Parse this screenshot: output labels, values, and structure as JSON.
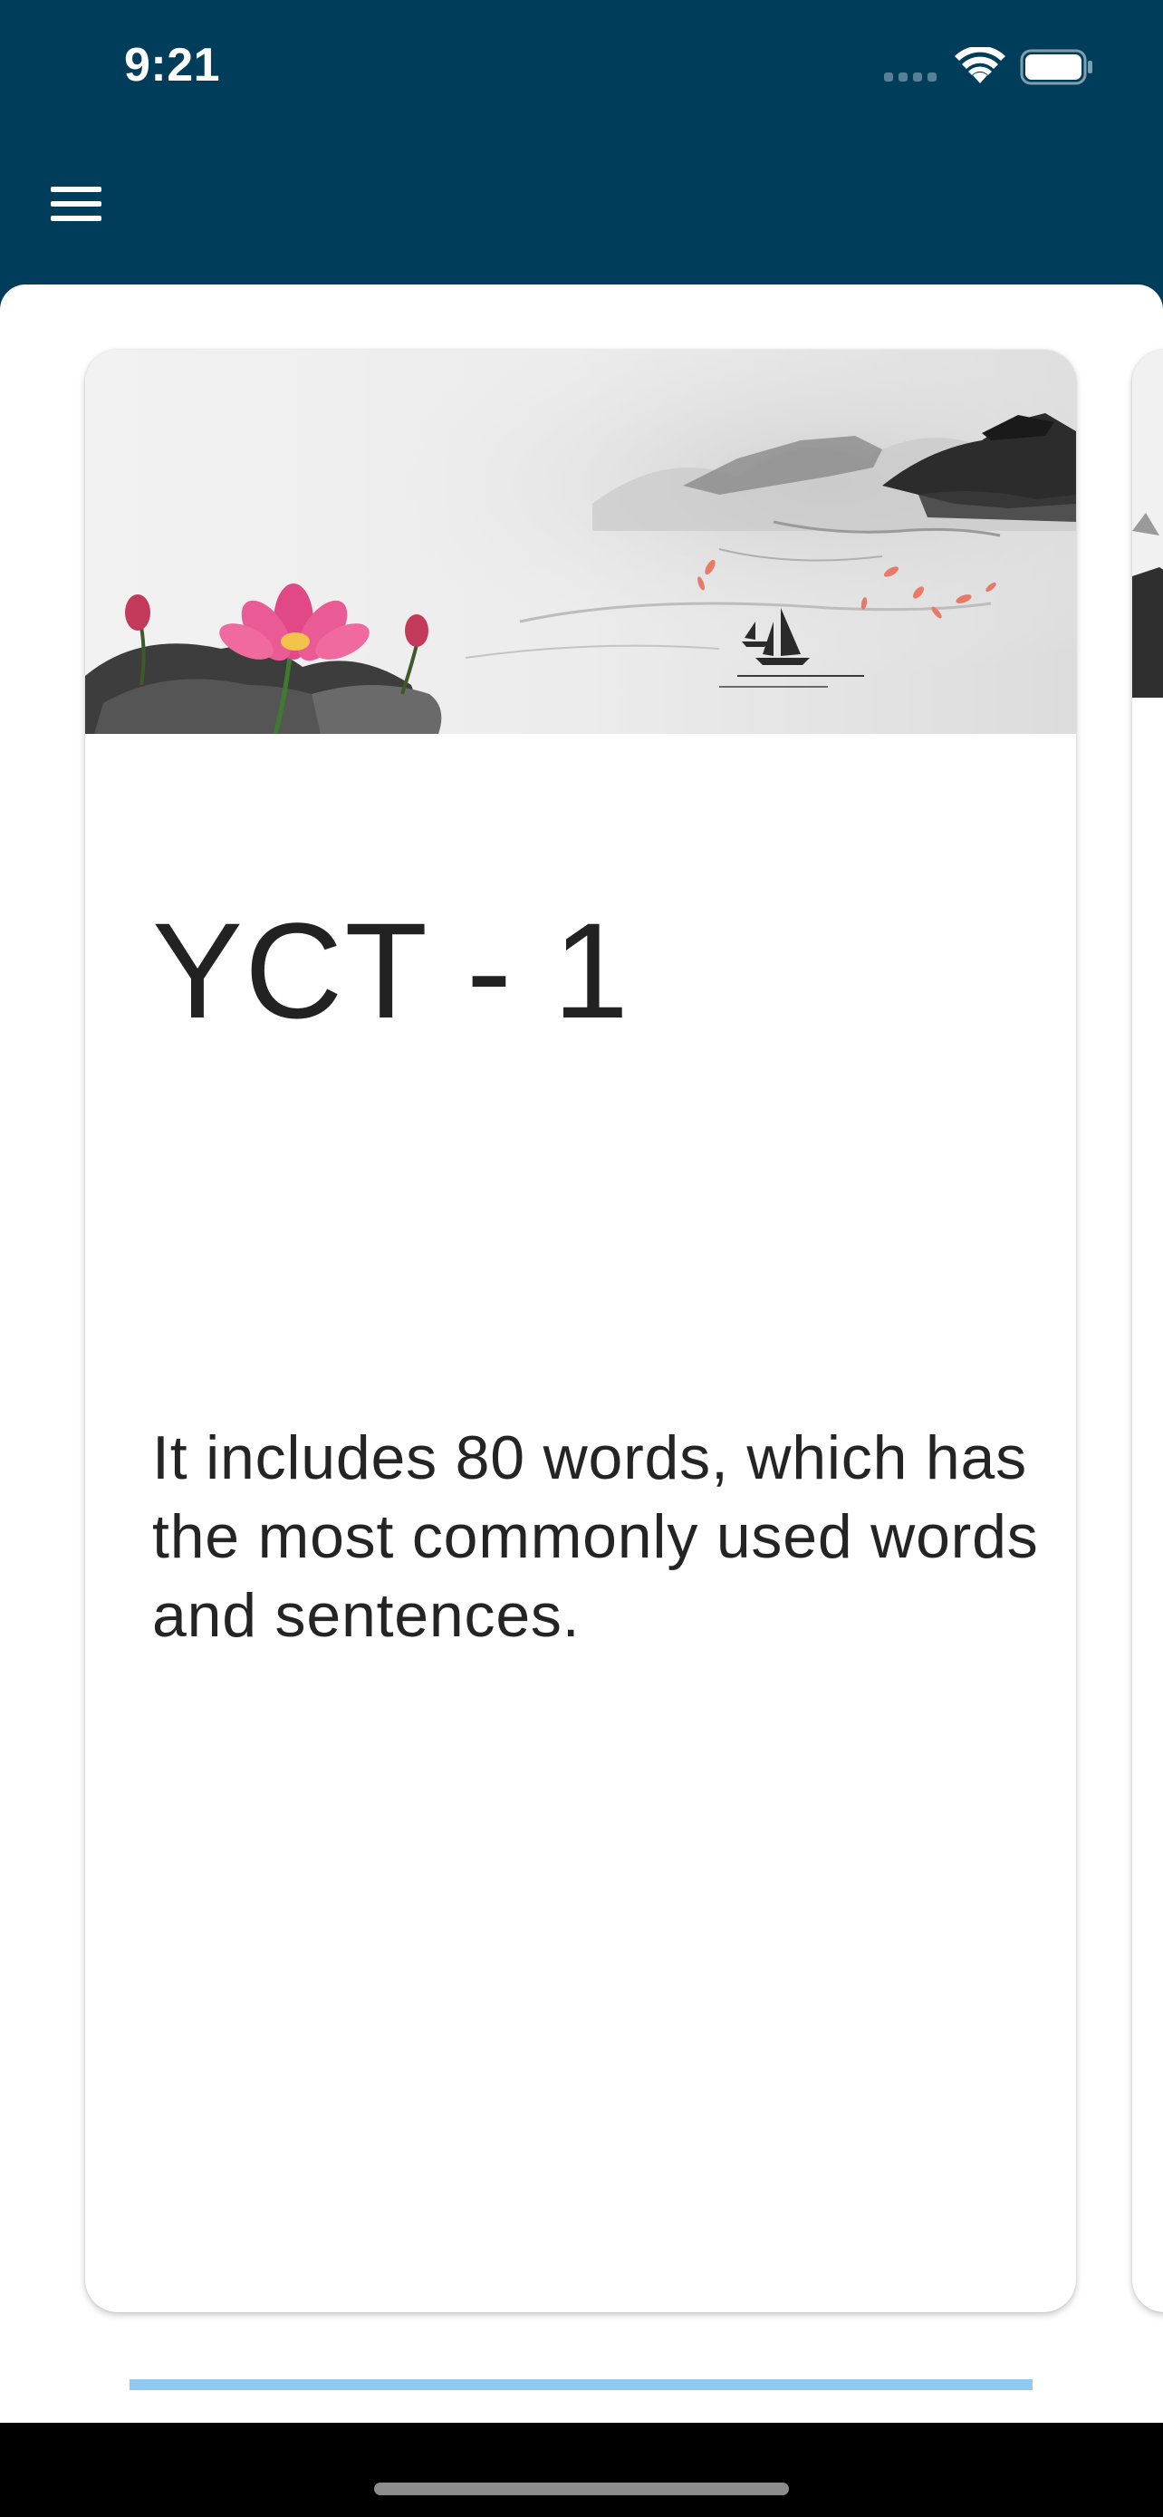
{
  "status_bar": {
    "time": "9:21",
    "icons": [
      "cellular-signal-icon",
      "wifi-icon",
      "battery-icon"
    ]
  },
  "app_bar": {
    "menu_icon": "hamburger-menu-icon",
    "background_color": "#003d5b"
  },
  "cards": [
    {
      "title": "YCT - 1",
      "description": "It includes 80 words, which has the most commonly used words and sentences.",
      "banner": "chinese-ink-painting-lotus-boats-landscape"
    }
  ],
  "page_indicator": {
    "color": "#90caf0"
  }
}
